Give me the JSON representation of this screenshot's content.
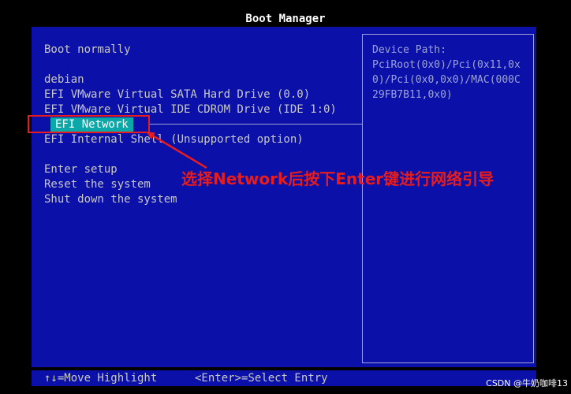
{
  "window": {
    "title": "Boot Manager"
  },
  "menu": {
    "items": [
      {
        "label": "Boot normally"
      },
      {
        "label": "debian"
      },
      {
        "label": "EFI VMware Virtual SATA Hard Drive (0.0)"
      },
      {
        "label": "EFI VMware Virtual IDE CDROM Drive (IDE 1:0)"
      },
      {
        "label": "EFI Network",
        "selected": true
      },
      {
        "label": "EFI Internal Shell (Unsupported option)"
      },
      {
        "label": "Enter setup"
      },
      {
        "label": "Reset the system"
      },
      {
        "label": "Shut down the system"
      }
    ]
  },
  "info_panel": {
    "heading": "Device Path:",
    "lines": [
      "PciRoot(0x0)/Pci(0x11,0x",
      "0)/Pci(0x0,0x0)/MAC(000C",
      "29FB7B11,0x0)"
    ]
  },
  "footer": {
    "move_hint": "↑↓=Move Highlight",
    "select_hint": "<Enter>=Select Entry"
  },
  "annotation": {
    "text": "选择Network后按下Enter键进行网络引导",
    "color": "#e81c1c"
  },
  "watermark": {
    "text": "CSDN @牛奶咖啡13"
  },
  "colors": {
    "panel_bg": "#0a10a8",
    "text": "#c8c8c8",
    "selected_bg": "#0aa8a8",
    "info_text": "#9ea4d8"
  }
}
